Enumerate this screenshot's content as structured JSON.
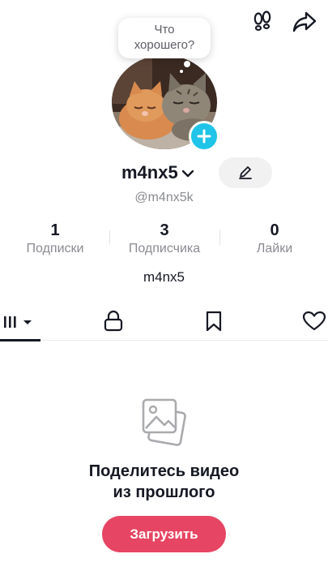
{
  "header": {
    "icons": [
      "footprints-icon",
      "share-icon"
    ]
  },
  "status_bubble": {
    "line1": "Что",
    "line2": "хорошего?"
  },
  "profile": {
    "username": "m4nx5",
    "handle": "@m4nx5k",
    "bio": "m4nx5"
  },
  "stats": [
    {
      "value": "1",
      "label": "Подписки"
    },
    {
      "value": "3",
      "label": "Подписчика"
    },
    {
      "value": "0",
      "label": "Лайки"
    }
  ],
  "tabs": [
    {
      "icon": "grid-icon",
      "active": true
    },
    {
      "icon": "lock-icon",
      "active": false
    },
    {
      "icon": "bookmark-icon",
      "active": false
    },
    {
      "icon": "heart-icon",
      "active": false
    }
  ],
  "empty_state": {
    "line1": "Поделитесь видео",
    "line2": "из прошлого",
    "button": "Загрузить"
  },
  "colors": {
    "accent": "#e64563",
    "badge": "#20c4e8",
    "text": "#161823",
    "muted": "#8a8b91"
  }
}
